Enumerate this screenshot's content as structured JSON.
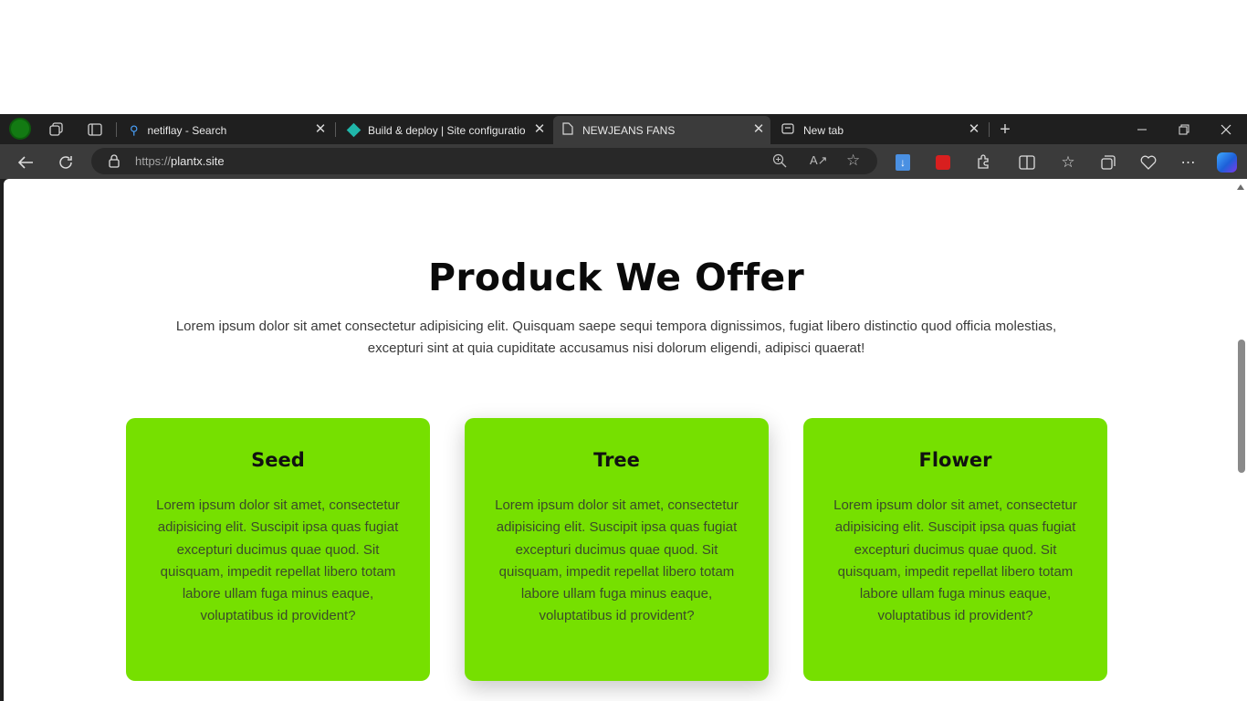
{
  "browser": {
    "tabs": [
      {
        "title": "netiflay - Search",
        "icon": "search-icon",
        "active": false
      },
      {
        "title": "Build & deploy | Site configuratio",
        "icon": "netlify-icon",
        "active": false
      },
      {
        "title": "NEWJEANS FANS",
        "icon": "page-icon",
        "active": true
      },
      {
        "title": "New tab",
        "icon": "new-tab-icon",
        "active": false
      }
    ],
    "address": {
      "scheme": "https://",
      "host": "plantx.site"
    }
  },
  "page": {
    "heading": "Produck We Offer",
    "intro": "Lorem ipsum dolor sit amet consectetur adipisicing elit. Quisquam saepe sequi tempora dignissimos, fugiat libero distinctio quod officia molestias, excepturi sint at quia cupiditate accusamus nisi dolorum eligendi, adipisci quaerat!",
    "cards": [
      {
        "title": "Seed",
        "body": "Lorem ipsum dolor sit amet, consectetur adipisicing elit. Suscipit ipsa quas fugiat excepturi ducimus quae quod. Sit quisquam, impedit repellat libero totam labore ullam fuga minus eaque, voluptatibus id provident?"
      },
      {
        "title": "Tree",
        "body": "Lorem ipsum dolor sit amet, consectetur adipisicing elit. Suscipit ipsa quas fugiat excepturi ducimus quae quod. Sit quisquam, impedit repellat libero totam labore ullam fuga minus eaque, voluptatibus id provident?"
      },
      {
        "title": "Flower",
        "body": "Lorem ipsum dolor sit amet, consectetur adipisicing elit. Suscipit ipsa quas fugiat excepturi ducimus quae quod. Sit quisquam, impedit repellat libero totam labore ullam fuga minus eaque, voluptatibus id provident?"
      }
    ]
  },
  "colors": {
    "card_green": "#76e000",
    "chrome_dark": "#1f1f1f",
    "chrome_toolbar": "#3b3b3b"
  }
}
